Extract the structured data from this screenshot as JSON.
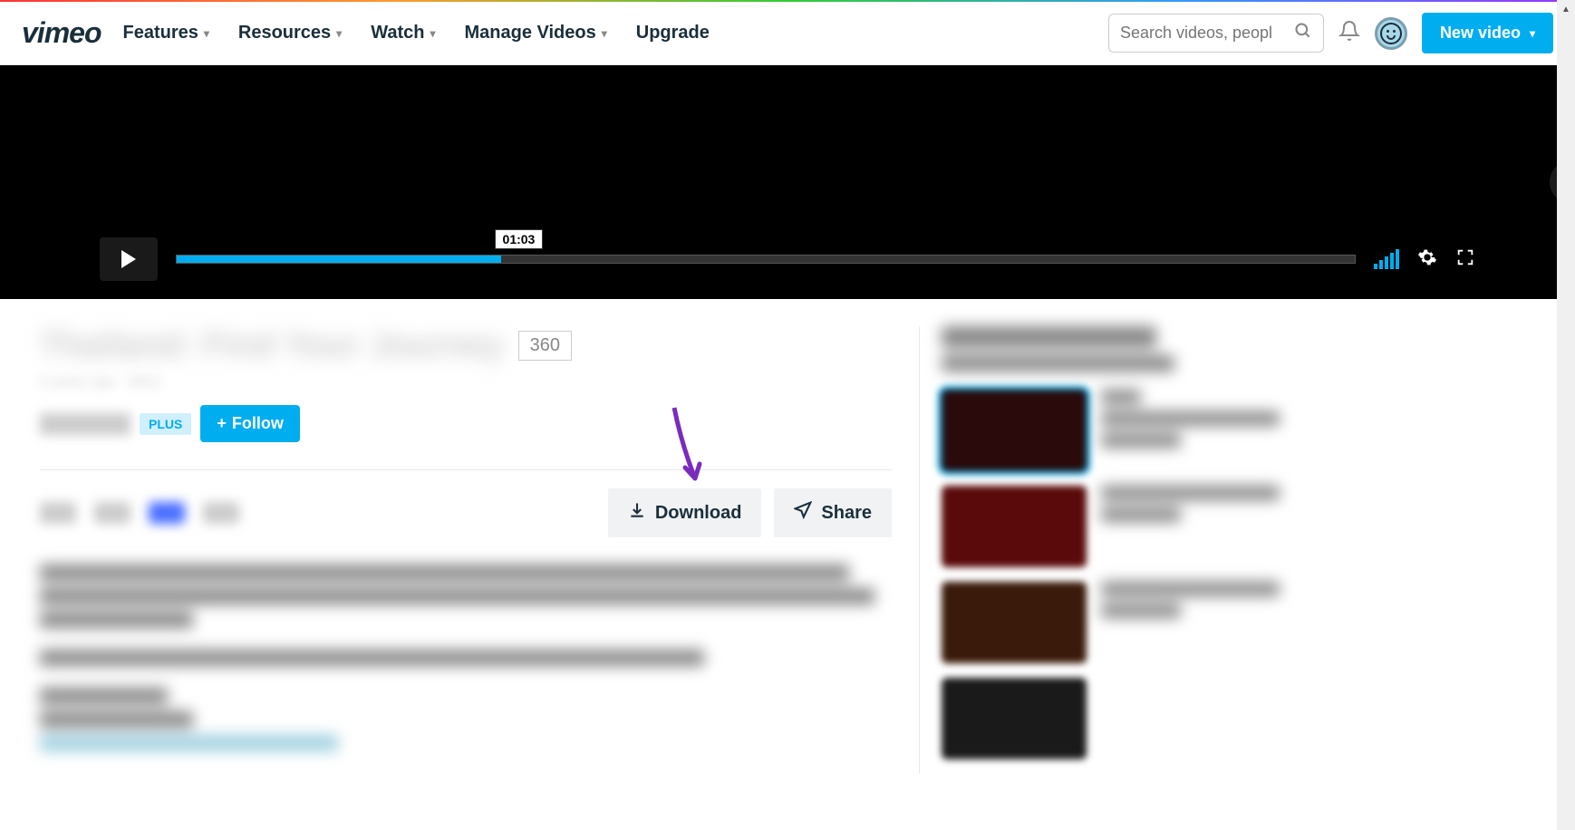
{
  "header": {
    "logo": "vimeo",
    "nav": {
      "features": "Features",
      "resources": "Resources",
      "watch": "Watch",
      "manage": "Manage Videos",
      "upgrade": "Upgrade"
    },
    "search_placeholder": "Search videos, peopl",
    "new_video": "New video"
  },
  "player": {
    "timestamp": "01:03"
  },
  "video": {
    "title_blurred": "Thailand: Find Your Journey",
    "badge": "360",
    "meta_blurred": "6 years ago · More",
    "plus_badge": "PLUS",
    "follow": "Follow",
    "download": "Download",
    "share": "Share"
  },
  "sidebar": {
    "heading_blurred": "More from Voyage"
  }
}
